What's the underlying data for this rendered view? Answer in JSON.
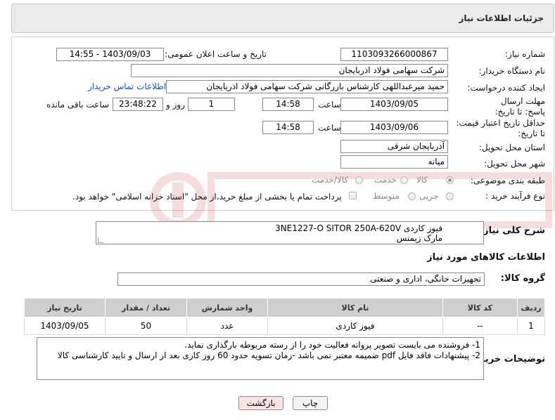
{
  "header": {
    "title": "جزئیات اطلاعات نیاز"
  },
  "form": {
    "need_number": {
      "label": "شماره نیاز:",
      "value": "1103093266000867"
    },
    "announce": {
      "label": "تاریخ و ساعت اعلان عمومی:",
      "value": "1403/09/03 - 14:55"
    },
    "buyer_org": {
      "label": "نام دستگاه خریدار:",
      "value": "شرکت سهامی فولاد اذربایجان"
    },
    "creator": {
      "label": "ایجاد کننده درخواست:",
      "value": "حمید میرعبداللهی کارشناس بازرگانی شرکت سهامی فولاد اذربایجان",
      "contact_link": "اطلاعات تماس خریدار"
    },
    "deadline": {
      "label": "مهلت ارسال پاسخ: تا تاریخ:",
      "date": "1403/09/05",
      "time_label": "ساعت",
      "time": "14:58",
      "days": "1",
      "days_label": "روز و",
      "remaining": "23:48:22",
      "remaining_label": "ساعت باقی مانده"
    },
    "validity": {
      "label": "حداقل تاریخ اعتبار قیمت: تا تاریخ:",
      "date": "1403/09/06",
      "time_label": "ساعت",
      "time": "14:58"
    },
    "province": {
      "label": "استان محل تحویل:",
      "value": "آذربایجان شرقی"
    },
    "city": {
      "label": "شهر محل تحویل:",
      "value": "میانه"
    },
    "category": {
      "label": "طبقه بندی موضوعی:",
      "options": [
        "کالا",
        "خدمت",
        "کالا/خدمت"
      ]
    },
    "process": {
      "label": "نوع فرآیند خرید :",
      "options": [
        "جزیی",
        "متوسط"
      ],
      "payment_note": "پرداخت تمام یا بخشی از مبلغ خرید،از محل \"اسناد خزانه اسلامی\" خواهد بود."
    }
  },
  "description": {
    "label": "شرح کلی نیاز:",
    "lines": [
      "فیوز کاردی 3NE1227-O SITOR 250A-620V",
      "مارک زیمنس"
    ]
  },
  "goods_info": {
    "title": "اطلاعات کالاهای مورد نیاز",
    "group_label": "گروه کالا:",
    "group_value": "تجهیزات خانگی، اداری و صنعتی",
    "table": {
      "headers": [
        "ردیف",
        "کد کالا",
        "نام کالا",
        "واحد شمارش",
        "تعداد / مقدار",
        "تاریخ نیاز"
      ],
      "rows": [
        [
          "1",
          "--",
          "فیوز کاردی",
          "عدد",
          "50",
          "1403/09/05"
        ]
      ]
    }
  },
  "buyer_notes": {
    "label": "توضیحات خریدار:",
    "lines": [
      "1- فروشنده می بایست تصویر پروانه فعالیت خود را از رسته مربوطه بارگذاری نماید.",
      "2- پیشنهادات فاقد فایل pdf  ضمیمه معتبر نمی باشد -زمان تسویه حدود 60  روز کاری بعد از ارسال و تایید کارشناسی کالا"
    ]
  },
  "buttons": {
    "print": "چاپ",
    "back": "بازگشت"
  },
  "colors": {
    "back_button_bg": "#fbe3e3",
    "link": "#1a4fbf",
    "table_header": "#cfcfcf"
  }
}
